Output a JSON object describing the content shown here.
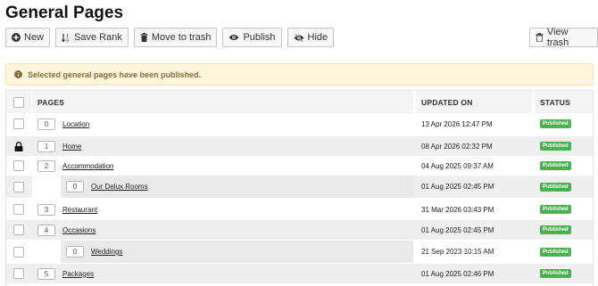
{
  "page": {
    "title": "General Pages"
  },
  "toolbar": {
    "new_label": "New",
    "save_rank_label": "Save Rank",
    "move_to_trash_label": "Move to trash",
    "publish_label": "Publish",
    "hide_label": "Hide",
    "view_trash_label": "View trash"
  },
  "alert": {
    "message": "Selected general pages have been published."
  },
  "table": {
    "headers": {
      "pages": "PAGES",
      "updated_on": "UPDATED ON",
      "status": "STATUS"
    },
    "rows": [
      {
        "rank": "0",
        "name": "Location",
        "updated": "13 Apr 2026 12:47 PM",
        "status": "Published",
        "level": 0,
        "locked": false
      },
      {
        "rank": "1",
        "name": "Home",
        "updated": "08 Apr 2026 02:32 PM",
        "status": "Published",
        "level": 0,
        "locked": true
      },
      {
        "rank": "2",
        "name": "Accommodation",
        "updated": "04 Aug 2025 09:37 AM",
        "status": "Published",
        "level": 0,
        "locked": false
      },
      {
        "rank": "0",
        "name": "Our Delux Rooms",
        "updated": "01 Aug 2025 02:45 PM",
        "status": "Published",
        "level": 1,
        "locked": false
      },
      {
        "rank": "3",
        "name": "Restaurant",
        "updated": "31 Mar 2026 03:43 PM",
        "status": "Published",
        "level": 0,
        "locked": false
      },
      {
        "rank": "4",
        "name": "Occasions",
        "updated": "01 Aug 2025 02:45 PM",
        "status": "Published",
        "level": 0,
        "locked": false
      },
      {
        "rank": "0",
        "name": "Weddings",
        "updated": "21 Sep 2023 10:15 AM",
        "status": "Published",
        "level": 1,
        "locked": false
      },
      {
        "rank": "5",
        "name": "Packages",
        "updated": "01 Aug 2025 02:46 PM",
        "status": "Published",
        "level": 0,
        "locked": false
      }
    ]
  },
  "colors": {
    "badge_green": "#4caf50",
    "alert_bg": "#fcf5dc",
    "alert_text": "#8a6d3b"
  }
}
